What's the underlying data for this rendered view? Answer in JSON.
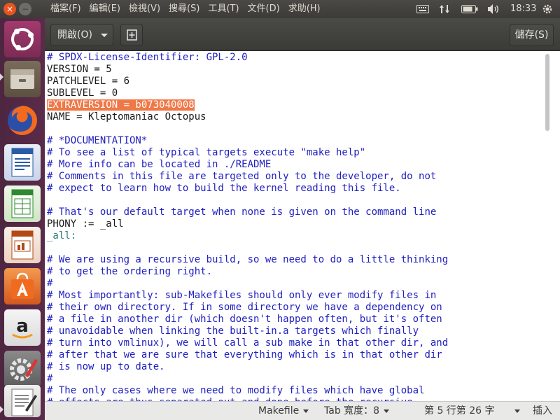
{
  "topbar": {
    "close_glyph": "×",
    "minimize_glyph": "−",
    "menus": [
      "檔案(F)",
      "編輯(E)",
      "檢視(V)",
      "搜尋(S)",
      "工具(T)",
      "文件(D)",
      "求助(H)"
    ],
    "tray_icons": [
      "keyboard-icon",
      "network-updown-icon",
      "battery-icon",
      "volume-icon",
      "gear-icon"
    ],
    "clock": "18:33"
  },
  "launcher": {
    "items": [
      "ubuntu-dash-icon",
      "files-icon",
      "firefox-icon",
      "libreoffice-writer-icon",
      "libreoffice-calc-icon",
      "libreoffice-impress-icon",
      "software-center-icon",
      "amazon-icon",
      "system-settings-icon",
      "text-editor-icon"
    ]
  },
  "header": {
    "open_label": "開啟(O)",
    "save_label": "儲存(S)"
  },
  "editor": {
    "lines": [
      {
        "text": "# SPDX-License-Identifier: GPL-2.0",
        "kind": "c"
      },
      {
        "text": "VERSION = 5",
        "kind": "n"
      },
      {
        "text": "PATCHLEVEL = 6",
        "kind": "n"
      },
      {
        "text": "SUBLEVEL = 0",
        "kind": "n"
      },
      {
        "text": "EXTRAVERSION = b073040008",
        "kind": "hl"
      },
      {
        "text": "NAME = Kleptomaniac Octopus",
        "kind": "n"
      },
      {
        "text": "",
        "kind": "n"
      },
      {
        "text": "# *DOCUMENTATION*",
        "kind": "c"
      },
      {
        "text": "# To see a list of typical targets execute \"make help\"",
        "kind": "c"
      },
      {
        "text": "# More info can be located in ./README",
        "kind": "c"
      },
      {
        "text": "# Comments in this file are targeted only to the developer, do not",
        "kind": "c"
      },
      {
        "text": "# expect to learn how to build the kernel reading this file.",
        "kind": "c"
      },
      {
        "text": "",
        "kind": "n"
      },
      {
        "text": "# That's our default target when none is given on the command line",
        "kind": "c"
      },
      {
        "text": "PHONY := _all",
        "kind": "n"
      },
      {
        "text": "_all:",
        "kind": "t"
      },
      {
        "text": "",
        "kind": "n"
      },
      {
        "text": "# We are using a recursive build, so we need to do a little thinking",
        "kind": "c"
      },
      {
        "text": "# to get the ordering right.",
        "kind": "c"
      },
      {
        "text": "#",
        "kind": "c"
      },
      {
        "text": "# Most importantly: sub-Makefiles should only ever modify files in",
        "kind": "c"
      },
      {
        "text": "# their own directory. If in some directory we have a dependency on",
        "kind": "c"
      },
      {
        "text": "# a file in another dir (which doesn't happen often, but it's often",
        "kind": "c"
      },
      {
        "text": "# unavoidable when linking the built-in.a targets which finally",
        "kind": "c"
      },
      {
        "text": "# turn into vmlinux), we will call a sub make in that other dir, and",
        "kind": "c"
      },
      {
        "text": "# after that we are sure that everything which is in that other dir",
        "kind": "c"
      },
      {
        "text": "# is now up to date.",
        "kind": "c"
      },
      {
        "text": "#",
        "kind": "c"
      },
      {
        "text": "# The only cases where we need to modify files which have global",
        "kind": "c"
      },
      {
        "text": "# effects are thus separated out and done before the recursive",
        "kind": "c"
      }
    ]
  },
  "statusbar": {
    "language": "Makefile",
    "tab_width": "Tab 寬度：8",
    "position": "第 5 行第 26 字",
    "mode": "插入"
  }
}
